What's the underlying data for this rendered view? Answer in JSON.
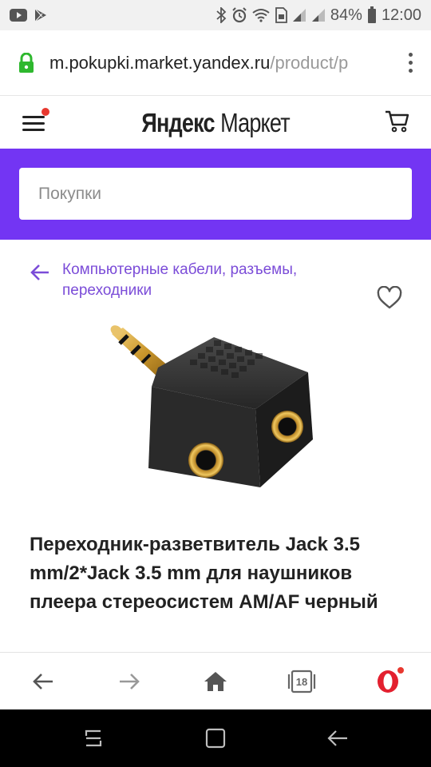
{
  "status_bar": {
    "battery_percent": "84%",
    "time": "12:00",
    "icons": [
      "youtube-icon",
      "play-store-icon",
      "bluetooth-icon",
      "alarm-icon",
      "wifi-icon",
      "sim-icon",
      "signal-icon",
      "signal-icon",
      "battery-icon"
    ]
  },
  "browser": {
    "url_host": "m.pokupki.market.yandex.ru",
    "url_path": "/product/p",
    "secure_icon": "lock-icon",
    "menu_icon": "kebab-icon"
  },
  "header": {
    "logo_brand": "Яндекс",
    "logo_product": "Маркет",
    "menu_icon": "hamburger-icon",
    "cart_icon": "cart-icon",
    "accent_color": "#7335f3",
    "notification_color": "#e8382f"
  },
  "search": {
    "placeholder": "Покупки"
  },
  "breadcrumb": {
    "text": "Компьютерные кабели, разъемы, переходники",
    "back_icon": "arrow-left-icon",
    "link_color": "#7b4cd8"
  },
  "favorite_icon": "heart-icon",
  "product": {
    "image_icon": "audio-splitter-adapter-image",
    "title": "Переходник-разветвитель Jack 3.5 mm/2*Jack 3.5 mm для наушников плеера стереосистем AM/AF черный"
  },
  "toolbar": {
    "tabs_count": "18",
    "icons": [
      "back-arrow-icon",
      "forward-arrow-icon",
      "home-icon",
      "tabs-icon",
      "opera-icon"
    ]
  },
  "nav_bar": {
    "icons": [
      "recents-icon",
      "home-square-icon",
      "back-icon"
    ]
  }
}
